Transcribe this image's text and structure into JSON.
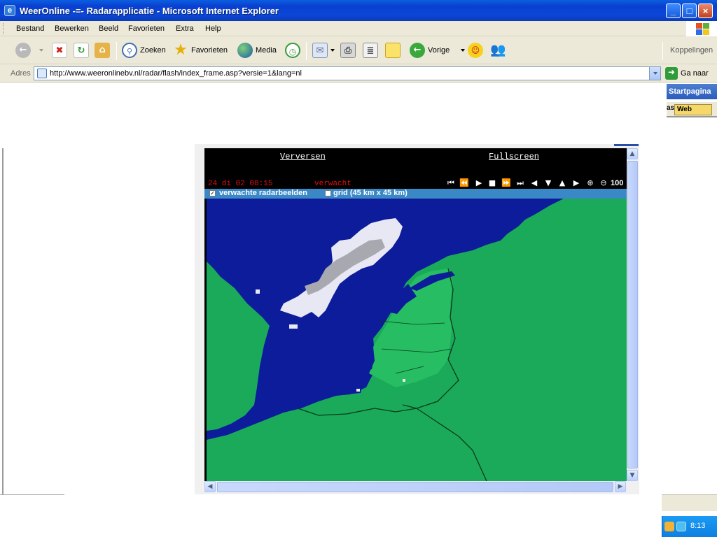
{
  "window": {
    "title": "WeerOnline -=- Radarapplicatie - Microsoft Internet Explorer",
    "minimize": "_",
    "maximize": "□",
    "close": "×"
  },
  "menu": [
    "Bestand",
    "Bewerken",
    "Beeld",
    "Favorieten",
    "Extra",
    "Help"
  ],
  "toolbar": {
    "search": "Zoeken",
    "favorites": "Favorieten",
    "media": "Media",
    "previous": "Vorige",
    "links": "Koppelingen"
  },
  "address": {
    "label": "Adres",
    "url": "http://www.weeronlinebv.nl/radar/flash/index_frame.asp?versie=1&lang=nl",
    "go": "Ga naar"
  },
  "links_bar": {
    "home": "Startpagina",
    "search_prefix": "as",
    "search_web": "Web"
  },
  "radar": {
    "refresh": "Verversen",
    "fullscreen": "Fullscreen",
    "timestamp": "24 di 02 08:15",
    "mode": "verwacht",
    "zoom": "100",
    "option_forecast": "verwachte radarbeelden",
    "option_forecast_checked": true,
    "option_grid": "grid (45 km x 45 km)",
    "option_grid_checked": false,
    "controls": [
      "first-icon",
      "rewind-icon",
      "play-icon",
      "stop-icon",
      "fast-forward-icon",
      "last-icon",
      "pan-left-icon",
      "pan-down-icon",
      "pan-up-icon",
      "pan-right-icon",
      "zoom-in-icon",
      "zoom-out-icon"
    ],
    "colors": {
      "sea": "#0c1c9a",
      "land": "#1aaa5a",
      "nl_land": "#24b860",
      "rain_light": "#e8e8f4",
      "rain_heavy": "#a8a8b0"
    }
  },
  "tray": {
    "clock": "8:13"
  }
}
